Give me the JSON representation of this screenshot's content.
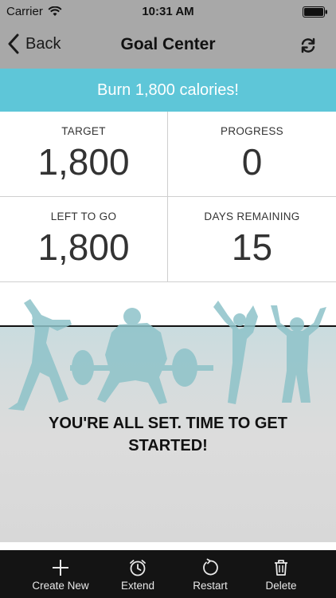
{
  "status_bar": {
    "carrier": "Carrier",
    "time": "10:31 AM"
  },
  "nav": {
    "back_label": "Back",
    "title": "Goal Center"
  },
  "goal": {
    "banner": "Burn 1,800 calories!"
  },
  "stats": [
    {
      "label": "TARGET",
      "value": "1,800"
    },
    {
      "label": "PROGRESS",
      "value": "0"
    },
    {
      "label": "LEFT TO GO",
      "value": "1,800"
    },
    {
      "label": "DAYS REMAINING",
      "value": "15"
    }
  ],
  "message": "YOU'RE ALL SET. TIME TO GET STARTED!",
  "tabs": [
    {
      "label": "Create New",
      "icon": "plus-icon"
    },
    {
      "label": "Extend",
      "icon": "alarm-clock-icon"
    },
    {
      "label": "Restart",
      "icon": "restart-icon"
    },
    {
      "label": "Delete",
      "icon": "trash-icon"
    }
  ],
  "colors": {
    "banner": "#5ec6d8",
    "bar": "#a8a8a8",
    "tab_bar": "#141414",
    "silhouette": "#8ec3c9"
  }
}
